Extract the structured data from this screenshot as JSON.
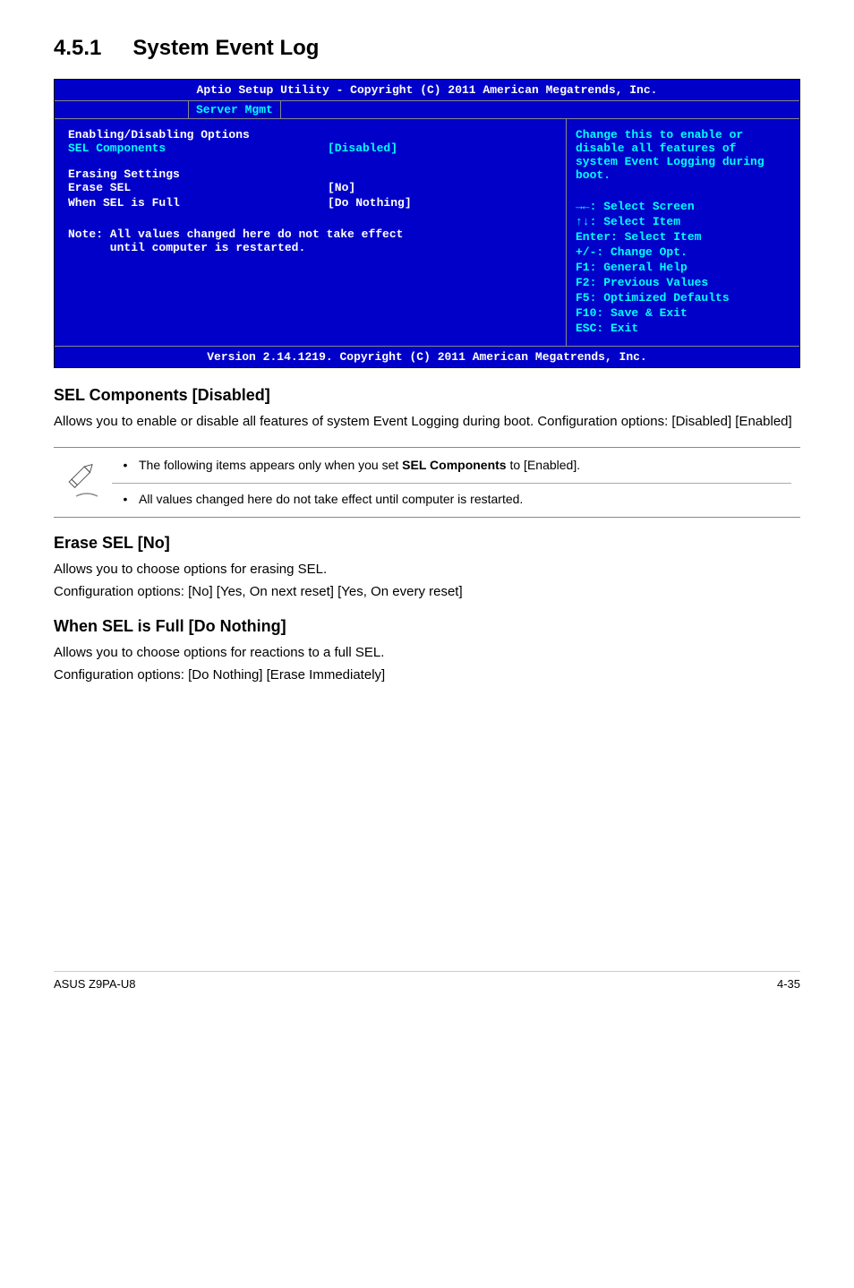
{
  "section": {
    "number": "4.5.1",
    "title": "System Event Log"
  },
  "bios": {
    "header": "Aptio Setup Utility - Copyright (C) 2011 American Megatrends, Inc.",
    "tab": "Server Mgmt",
    "group1_title": "Enabling/Disabling Options",
    "sel_components_label": "SEL Components",
    "sel_components_value": "[Disabled]",
    "group2_title": "Erasing Settings",
    "erase_sel_label": "Erase SEL",
    "erase_sel_value": "[No]",
    "when_full_label": "When SEL is Full",
    "when_full_value": "[Do Nothing]",
    "note_line1": "Note: All values changed here do not take effect",
    "note_line2": "      until computer is restarted.",
    "help_line1": "Change this to enable or",
    "help_line2": "disable all features of",
    "help_line3": "system Event Logging during",
    "help_line4": "boot.",
    "nav1": "→←: Select Screen",
    "nav2": "↑↓:  Select Item",
    "nav3": "Enter: Select Item",
    "nav4": "+/-: Change Opt.",
    "nav5": "F1: General Help",
    "nav6": "F2: Previous Values",
    "nav7": "F5: Optimized Defaults",
    "nav8": "F10: Save & Exit",
    "nav9": "ESC: Exit",
    "footer": "Version 2.14.1219. Copyright (C) 2011 American Megatrends, Inc."
  },
  "content": {
    "h1": "SEL Components [Disabled]",
    "p1": "Allows you to enable or disable all features of system Event Logging during boot. Configuration options: [Disabled] [Enabled]",
    "note1a": "The following items appears only when you set ",
    "note1b": "SEL Components",
    "note1c": " to [Enabled].",
    "note2": "All values changed here do not take effect until computer is restarted.",
    "h2": "Erase SEL [No]",
    "p2a": "Allows you to choose options for erasing SEL.",
    "p2b": "Configuration options: [No] [Yes, On next reset] [Yes, On every reset]",
    "h3": "When SEL is Full [Do Nothing]",
    "p3a": "Allows you to choose options for reactions to a full SEL.",
    "p3b": "Configuration options: [Do Nothing] [Erase Immediately]"
  },
  "footer": {
    "left": "ASUS Z9PA-U8",
    "right": "4-35"
  }
}
